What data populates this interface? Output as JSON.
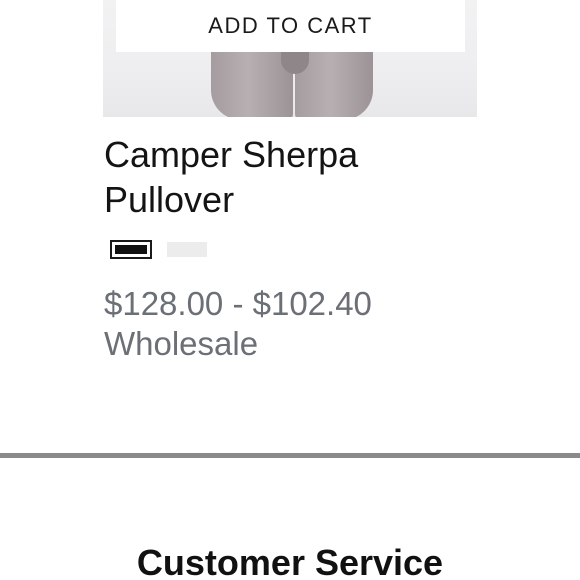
{
  "product": {
    "add_to_cart_label": "ADD TO CART",
    "title_line1": "Camper Sherpa",
    "title_line2": "Pullover",
    "swatches": [
      {
        "name": "black",
        "color": "#111111",
        "selected": true
      },
      {
        "name": "white",
        "color": "#ececec",
        "selected": false
      }
    ],
    "price_range": "$128.00 - $102.40",
    "price_note": "Wholesale"
  },
  "footer": {
    "heading": "Customer Service"
  },
  "colors": {
    "price_text": "#6b6f76",
    "divider": "#8a8a8a"
  }
}
